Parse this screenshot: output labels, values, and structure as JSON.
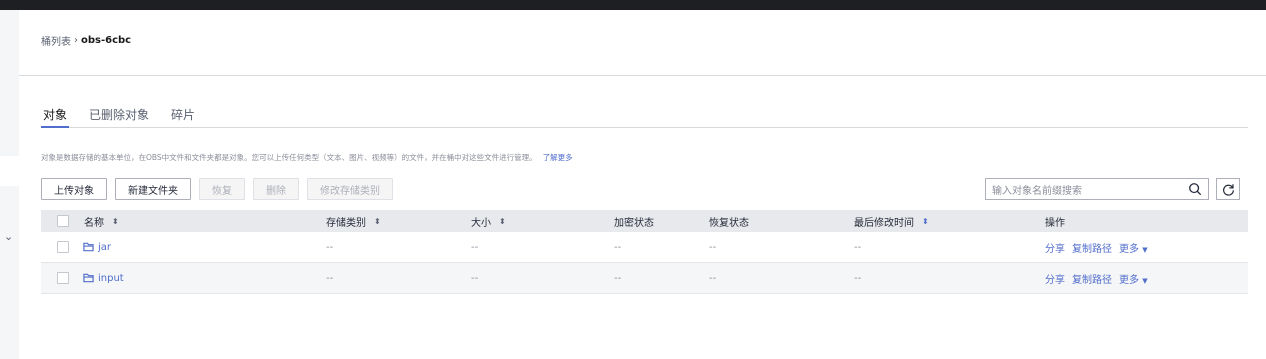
{
  "breadcrumb": {
    "parent": "桶列表",
    "separator": "›",
    "current": "obs-6cbc"
  },
  "tabs": [
    {
      "label": "对象"
    },
    {
      "label": "已删除对象"
    },
    {
      "label": "碎片"
    }
  ],
  "description": {
    "text": "对象是数据存储的基本单位，在OBS中文件和文件夹都是对象。您可以上传任何类型（文本、图片、视频等）的文件，并在桶中对这些文件进行管理。",
    "link": "了解更多"
  },
  "toolbar": {
    "upload": "上传对象",
    "new_folder": "新建文件夹",
    "restore": "恢复",
    "delete": "删除",
    "change_class": "修改存储类别"
  },
  "search": {
    "placeholder": "输入对象名前缀搜索"
  },
  "table": {
    "headers": {
      "name": "名称",
      "storage_class": "存储类别",
      "size": "大小",
      "encryption": "加密状态",
      "restore": "恢复状态",
      "modified": "最后修改时间",
      "ops": "操作"
    },
    "rows": [
      {
        "name": "jar",
        "storage_class": "--",
        "size": "--",
        "encryption": "--",
        "restore": "--",
        "modified": "--"
      },
      {
        "name": "input",
        "storage_class": "--",
        "size": "--",
        "encryption": "--",
        "restore": "--",
        "modified": "--"
      }
    ],
    "ops": {
      "share": "分享",
      "copy_path": "复制路径",
      "more": "更多"
    }
  },
  "colors": {
    "accent": "#526ecc",
    "header_bg": "#e8e9ec",
    "topbar": "#1e1f23"
  }
}
